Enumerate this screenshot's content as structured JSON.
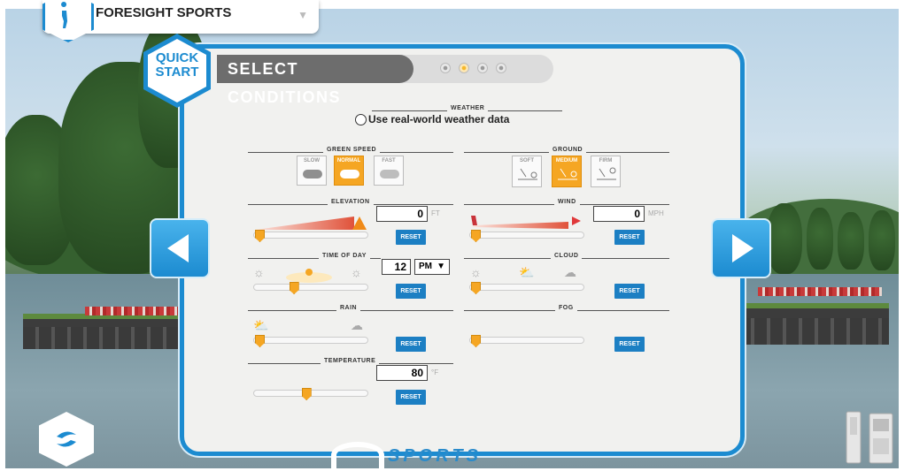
{
  "header": {
    "app_title": "FORESIGHT SPORTS",
    "quick_start": "QUICK START",
    "quick_line1": "QUICK",
    "quick_line2": "START",
    "title": "SELECT CONDITIONS",
    "steps_total": 4,
    "active_step": 2
  },
  "weather": {
    "section": "WEATHER",
    "option": "Use real-world weather data",
    "selected": false
  },
  "green_speed": {
    "section": "GREEN SPEED",
    "options": [
      "SLOW",
      "NORMAL",
      "FAST"
    ],
    "selected": "NORMAL"
  },
  "ground": {
    "section": "GROUND",
    "options": [
      "SOFT",
      "MEDIUM",
      "FIRM"
    ],
    "selected": "MEDIUM"
  },
  "elevation": {
    "section": "ELEVATION",
    "value": "0",
    "unit": "FT",
    "reset": "RESET",
    "level": 0.0
  },
  "wind": {
    "section": "WIND",
    "value": "0",
    "unit": "MPH",
    "reset": "RESET",
    "level": 0.0
  },
  "time_of_day": {
    "section": "TIME OF DAY",
    "hour": "12",
    "ampm": "PM",
    "reset": "RESET",
    "level": 0.33
  },
  "cloud": {
    "section": "CLOUD",
    "reset": "RESET",
    "level": 0.0
  },
  "rain": {
    "section": "RAIN",
    "reset": "RESET",
    "level": 0.0
  },
  "fog": {
    "section": "FOG",
    "reset": "RESET",
    "level": 0.0
  },
  "temperature": {
    "section": "TEMPERATURE",
    "value": "80",
    "unit": "°F",
    "reset": "RESET",
    "level": 0.45
  },
  "footer": {
    "brand_text": "SPORTS"
  },
  "colors": {
    "accent": "#1c8bd0",
    "orange": "#f5a623",
    "reset_blue": "#1c7fc3"
  }
}
